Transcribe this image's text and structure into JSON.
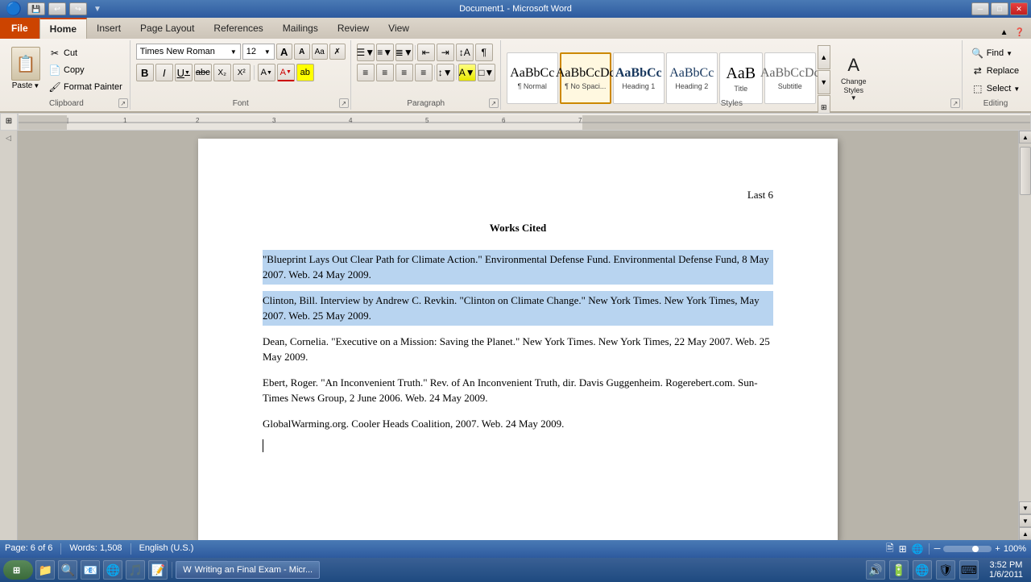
{
  "titlebar": {
    "title": "Document1 - Microsoft Word",
    "quick_access": [
      "save",
      "undo",
      "redo"
    ]
  },
  "ribbon": {
    "file_tab": "File",
    "tabs": [
      "Home",
      "Insert",
      "Page Layout",
      "References",
      "Mailings",
      "Review",
      "View"
    ],
    "active_tab": "Home"
  },
  "clipboard": {
    "group_label": "Clipboard",
    "paste_label": "Paste",
    "cut_label": "Cut",
    "copy_label": "Copy",
    "format_painter_label": "Format Painter"
  },
  "font": {
    "group_label": "Font",
    "name": "Times New Roman",
    "size": "12",
    "bold": "B",
    "italic": "I",
    "underline": "U",
    "strikethrough": "abc",
    "subscript": "X₂",
    "superscript": "X²",
    "grow": "A",
    "shrink": "A",
    "case": "Aa",
    "clear": "✗"
  },
  "paragraph": {
    "group_label": "Paragraph"
  },
  "styles": {
    "group_label": "Styles",
    "items": [
      {
        "label": "¶ Normal",
        "sublabel": "Normal",
        "active": false
      },
      {
        "label": "¶ No Spaci...",
        "sublabel": "¶ No Spaci...",
        "active": true
      },
      {
        "label": "Heading 1",
        "sublabel": "Heading 1",
        "active": false
      },
      {
        "label": "Heading 2",
        "sublabel": "Heading 2",
        "active": false
      },
      {
        "label": "Title",
        "sublabel": "Title",
        "active": false
      },
      {
        "label": "Subtitle",
        "sublabel": "Subtitle",
        "active": false
      }
    ],
    "change_styles_label": "Change\nStyles",
    "change_styles_arrow": "▼"
  },
  "editing": {
    "group_label": "Editing",
    "find_label": "Find",
    "replace_label": "Replace",
    "select_label": "Select"
  },
  "document": {
    "header_right": "Last 6",
    "title": "Works Cited",
    "citations": [
      {
        "text": "\"Blueprint Lays Out Clear Path for Climate Action.\" Environmental Defense Fund. Environmental Defense Fund, 8 May 2007. Web. 24 May 2009.",
        "selected": true
      },
      {
        "text": "Clinton, Bill. Interview by Andrew C. Revkin. \"Clinton on Climate Change.\" New York Times. New York Times, May 2007. Web. 25 May 2009.",
        "selected": true
      },
      {
        "text": "Dean, Cornelia. \"Executive on a Mission: Saving the Planet.\" New York Times. New York Times, 22 May 2007. Web. 25 May 2009.",
        "selected": false
      },
      {
        "text": "Ebert, Roger. \"An Inconvenient Truth.\" Rev. of An Inconvenient Truth, dir. Davis Guggenheim. Rogerebert.com. Sun-Times News Group, 2 June 2006. Web. 24 May 2009.",
        "selected": false
      },
      {
        "text": "GlobalWarming.org. Cooler Heads Coalition, 2007. Web. 24 May 2009.",
        "selected": false
      }
    ]
  },
  "statusbar": {
    "page_info": "Page: 6 of 6",
    "words": "Words: 1,508",
    "language": "English (U.S.)",
    "zoom": "100%"
  },
  "taskbar": {
    "time": "3:52 PM",
    "date": "1/6/2011",
    "active_window": "Writing an Final Exam - Micr..."
  }
}
